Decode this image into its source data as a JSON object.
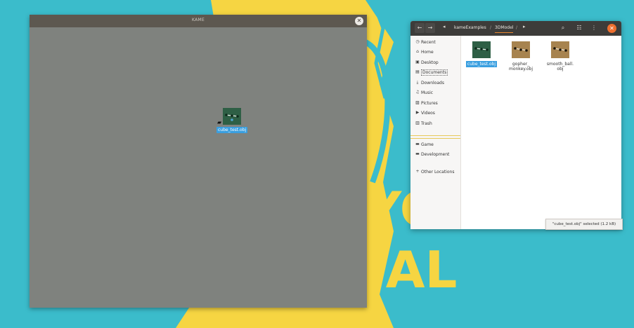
{
  "desktop": {
    "background_color": "#3bbccb",
    "wallpaper_color": "#f6d542",
    "wallpaper_text_1": "YO",
    "wallpaper_text_2": "IAL"
  },
  "kame_window": {
    "title": "KAME",
    "close_icon": "close-icon",
    "dragged_item": {
      "label": "cube_test.obj"
    }
  },
  "file_manager": {
    "nav": {
      "back_icon": "arrow-left-icon",
      "forward_icon": "arrow-right-icon"
    },
    "breadcrumb": [
      "kameExamples",
      "3DModel"
    ],
    "header_icons": [
      "search-icon",
      "view-list-icon",
      "menu-icon",
      "close-icon"
    ],
    "sidebar": {
      "places": [
        {
          "label": "Recent",
          "icon": "clock-icon"
        },
        {
          "label": "Home",
          "icon": "home-icon"
        },
        {
          "label": "Desktop",
          "icon": "desktop-icon"
        },
        {
          "label": "Documents",
          "icon": "document-icon"
        },
        {
          "label": "Downloads",
          "icon": "download-icon"
        },
        {
          "label": "Music",
          "icon": "music-icon"
        },
        {
          "label": "Pictures",
          "icon": "picture-icon"
        },
        {
          "label": "Videos",
          "icon": "video-icon"
        },
        {
          "label": "Trash",
          "icon": "trash-icon"
        }
      ],
      "bookmarks": [
        {
          "label": "Game",
          "icon": "folder-icon"
        },
        {
          "label": "Development",
          "icon": "folder-icon"
        }
      ],
      "other": {
        "label": "Other Locations",
        "icon": "plus-icon"
      }
    },
    "files": [
      {
        "name_1": "cube_test.obj",
        "name_2": "",
        "selected": true
      },
      {
        "name_1": "gopher_",
        "name_2": "monkey.obj",
        "selected": false
      },
      {
        "name_1": "smooth_ball.",
        "name_2": "obj",
        "selected": false
      }
    ],
    "status": "\"cube_test.obj\" selected  (1.2 kB)"
  }
}
